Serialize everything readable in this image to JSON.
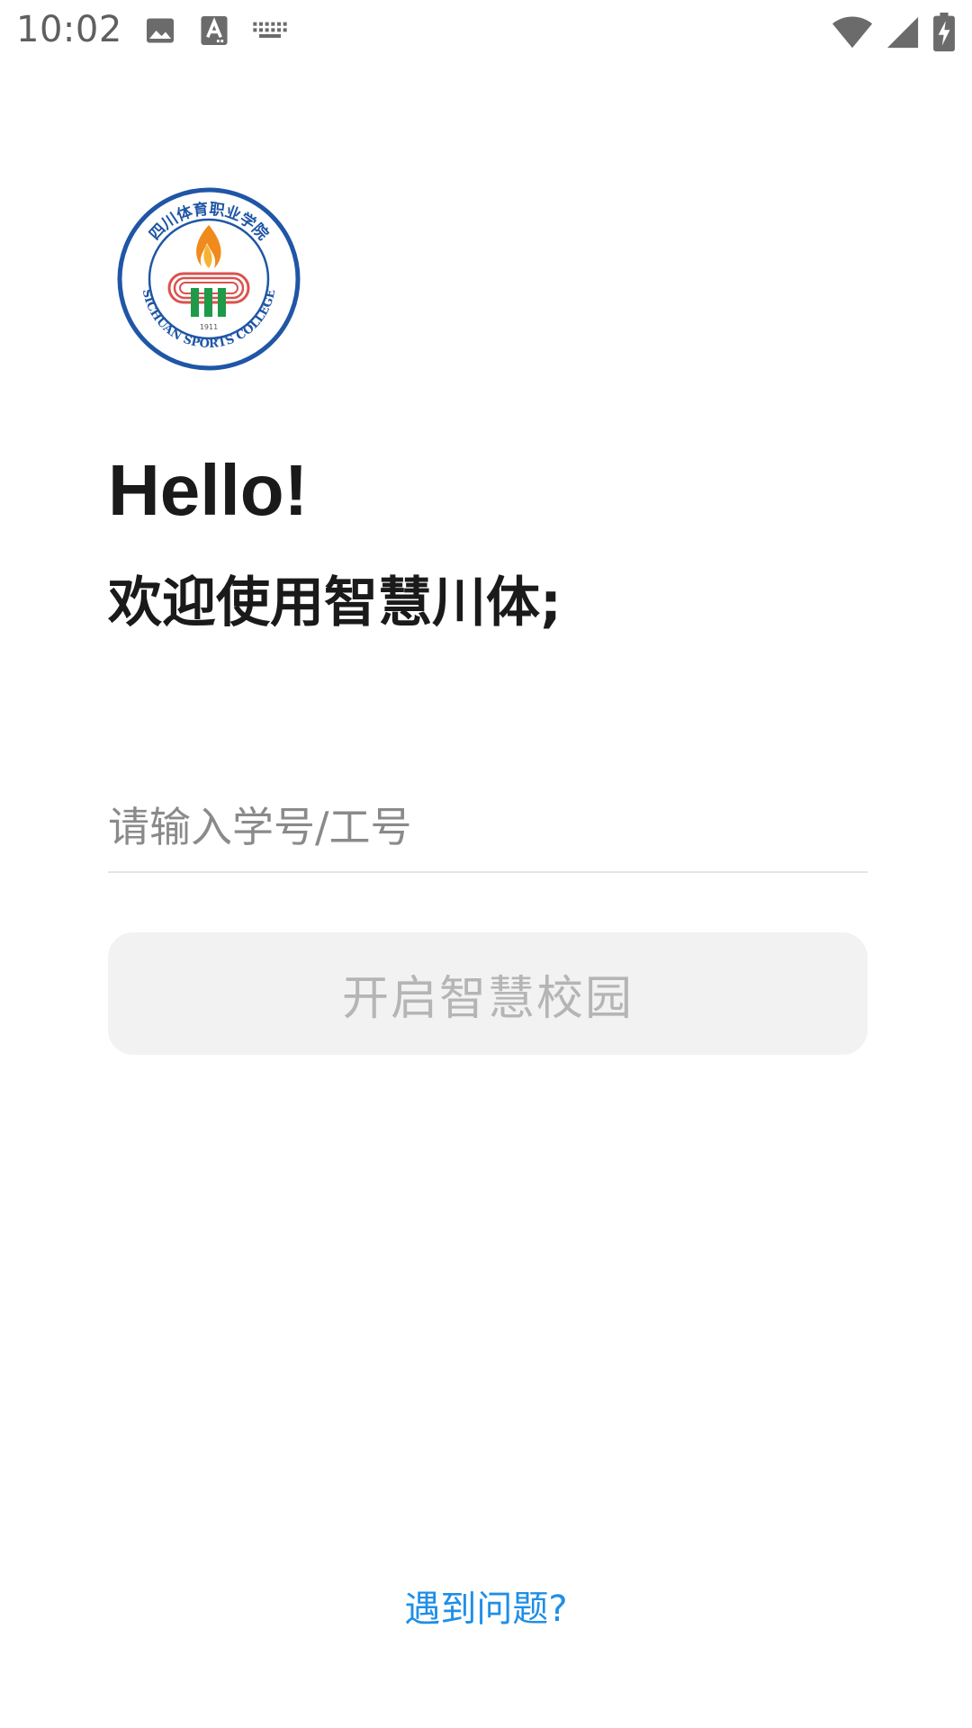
{
  "status_bar": {
    "time": "10:02",
    "left_icons": [
      "image-icon",
      "text-a-icon",
      "keyboard-icon"
    ],
    "right_icons": [
      "wifi-icon",
      "cell-signal-icon",
      "battery-charging-icon"
    ]
  },
  "logo": {
    "text_top": "四川体育职业学院",
    "text_bottom": "SICHUAN SPORTS COLLEGE",
    "year": "1911",
    "colors": {
      "ring": "#1f56a6",
      "flame": "#f08a1c",
      "track": "#d9534f",
      "pillars": "#1e9a48"
    }
  },
  "greeting": {
    "hello": "Hello!",
    "welcome": "欢迎使用智慧川体;"
  },
  "login": {
    "input_placeholder": "请输入学号/工号",
    "input_value": "",
    "submit_label": "开启智慧校园"
  },
  "footer": {
    "help_label": "遇到问题?"
  },
  "colors": {
    "accent_link": "#1f8fe6",
    "button_bg": "#f2f2f2",
    "button_text": "#b5b5b5"
  }
}
